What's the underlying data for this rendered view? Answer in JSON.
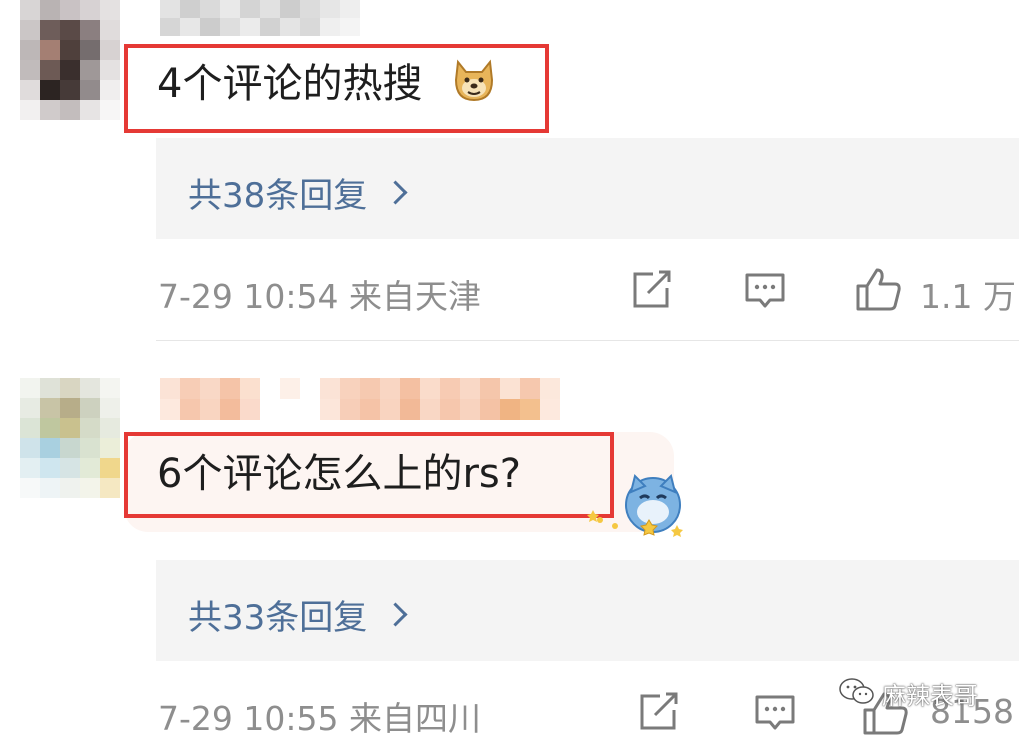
{
  "comments": [
    {
      "text": "4个评论的热搜",
      "emoji": "doge-emoji",
      "reply_link": "共38条回复",
      "meta": "7-29 10:54 来自天津",
      "likes": "1.1 万"
    },
    {
      "text": "6个评论怎么上的rs?",
      "emoji": "blue-cat-sticker",
      "reply_link": "共33条回复",
      "meta": "7-29 10:55 来自四川",
      "likes": "8158"
    }
  ],
  "watermark": "麻辣表哥",
  "colors": {
    "highlight_box": "#e53935",
    "reply_link": "#4e6f98",
    "meta_text": "#8e8e8e",
    "reply_bg": "#f4f4f4"
  }
}
